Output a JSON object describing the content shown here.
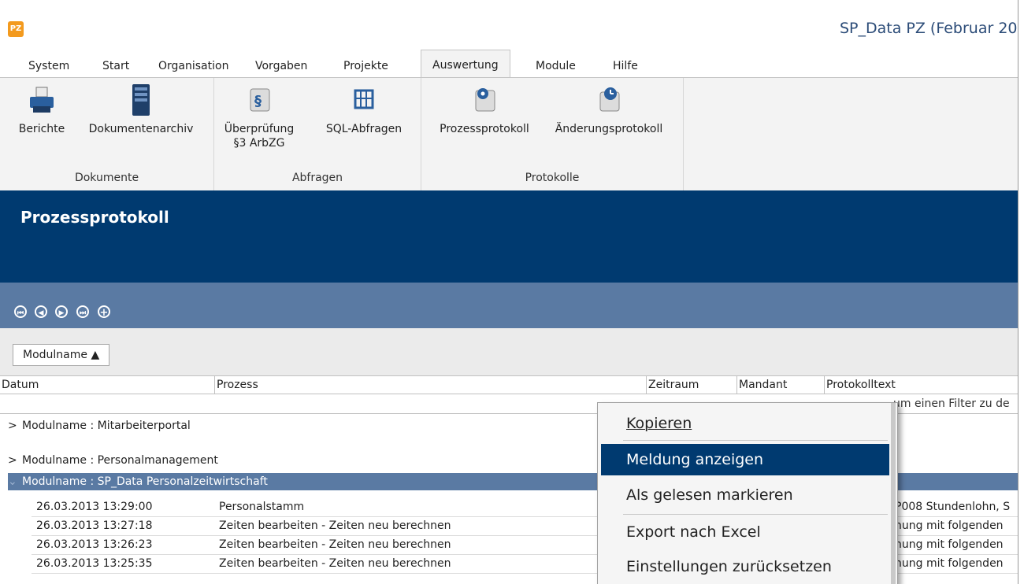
{
  "app": {
    "icon_text": "PZ",
    "title": "SP_Data PZ (Februar 20"
  },
  "menu": [
    "System",
    "Start",
    "Organisation",
    "Vorgaben",
    "Projekte",
    "Auswertung",
    "Module",
    "Hilfe"
  ],
  "ribbon": {
    "groups": [
      {
        "label": "Dokumente",
        "buttons": [
          {
            "label": "Berichte",
            "icon": "printer-icon"
          },
          {
            "label": "Dokumentenarchiv",
            "icon": "archive-server-icon"
          }
        ]
      },
      {
        "label": "Abfragen",
        "buttons": [
          {
            "label": "Überprüfung\n§3 ArbZG",
            "icon": "paragraph-scroll-icon"
          },
          {
            "label": "SQL-Abfragen",
            "icon": "sql-grid-icon"
          }
        ]
      },
      {
        "label": "Protokolle",
        "buttons": [
          {
            "label": "Prozessprotokoll",
            "icon": "gear-scroll-icon"
          },
          {
            "label": "Änderungsprotokoll",
            "icon": "clock-scroll-icon"
          }
        ]
      }
    ]
  },
  "header": {
    "title": "Prozessprotokoll"
  },
  "nav": {
    "buttons": [
      "first-icon",
      "previous-icon",
      "next-icon",
      "last-icon",
      "add-icon"
    ]
  },
  "grid": {
    "group_chip": "Modulname  ▲",
    "columns": [
      "Datum",
      "Prozess",
      "Zeitraum",
      "Mandant",
      "Protokolltext"
    ],
    "filter_hint": "um einen Filter zu de",
    "groups": [
      {
        "label": "Modulname : Mitarbeiterportal",
        "expander": ">"
      },
      {
        "label": "Modulname : Personalmanagement",
        "expander": ">"
      },
      {
        "label": "Modulname : SP_Data Personalzeitwirtschaft",
        "expander": "⌄"
      }
    ],
    "rows": [
      {
        "datum": "26.03.2013 13:29:00",
        "prozess": "Personalstamm",
        "text": "P008 Stundenlohn, S"
      },
      {
        "datum": "26.03.2013 13:27:18",
        "prozess": "Zeiten bearbeiten - Zeiten neu berechnen",
        "text": "hung mit folgenden"
      },
      {
        "datum": "26.03.2013 13:26:23",
        "prozess": "Zeiten bearbeiten - Zeiten neu berechnen",
        "text": "hung mit folgenden"
      },
      {
        "datum": "26.03.2013 13:25:35",
        "prozess": "Zeiten bearbeiten - Zeiten neu berechnen",
        "text": "hung mit folgenden"
      }
    ]
  },
  "context_menu": {
    "items": [
      {
        "label": "Kopieren",
        "accel": "K"
      },
      {
        "label": "Meldung anzeigen",
        "accel": "M",
        "highlighted": true
      },
      {
        "label": "Als gelesen markieren",
        "accel": "g"
      },
      {
        "label": "Export nach Excel",
        "accel": "x"
      },
      {
        "label": "Einstellungen zurücksetzen",
        "accel": "E"
      }
    ]
  },
  "colors": {
    "header": "#003a70",
    "nav": "#5a7aa3",
    "selected_group": "#5a7aa3",
    "highlight": "#003a70",
    "app_icon": "#f39a1e"
  }
}
